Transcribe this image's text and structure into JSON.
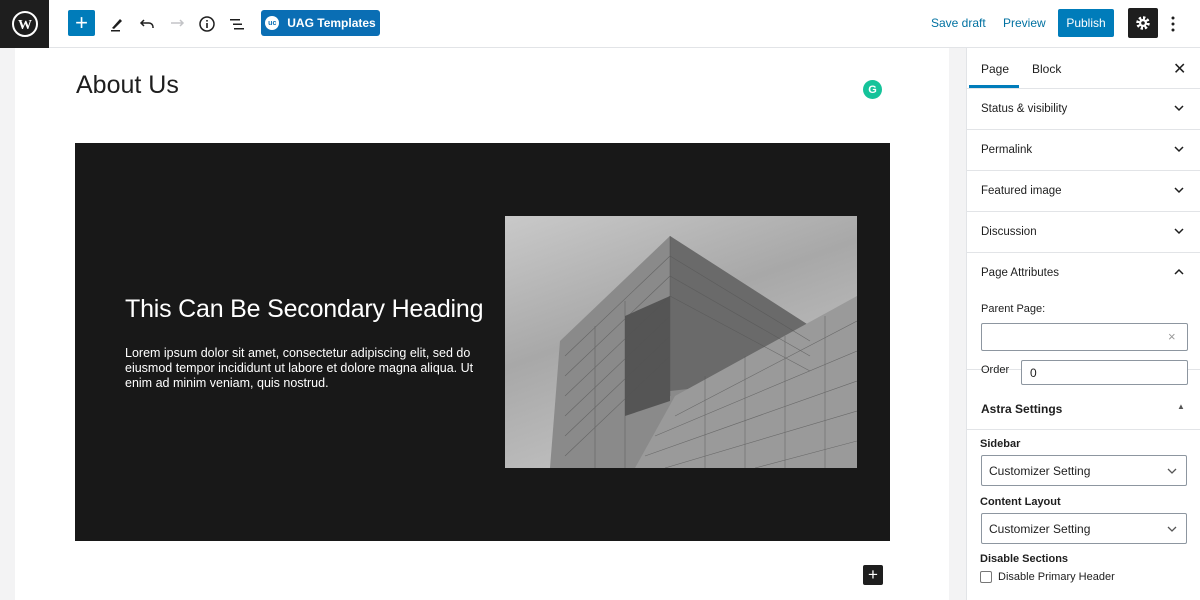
{
  "toolbar": {
    "uag_label": "UAG Templates",
    "uag_logo": "uc",
    "save_draft": "Save draft",
    "preview": "Preview",
    "publish": "Publish",
    "accent": "#007cba"
  },
  "editor": {
    "page_title": "About Us",
    "cover": {
      "heading": "This Can Be Secondary Heading",
      "paragraph": "Lorem ipsum dolor sit amet, consectetur adipiscing elit, sed do eiusmod tempor incididunt ut labore et dolore magna aliqua. Ut enim ad minim veniam, quis nostrud.",
      "image_alt": "Black and white photo of a glass office building"
    }
  },
  "sidebar": {
    "tabs": [
      {
        "label": "Page",
        "active": true
      },
      {
        "label": "Block",
        "active": false
      }
    ],
    "panels": [
      {
        "label": "Status & visibility",
        "open": false
      },
      {
        "label": "Permalink",
        "open": false
      },
      {
        "label": "Featured image",
        "open": false
      },
      {
        "label": "Discussion",
        "open": false
      },
      {
        "label": "Page Attributes",
        "open": true
      }
    ],
    "page_attributes": {
      "parent_label": "Parent Page:",
      "parent_value": "",
      "order_label": "Order",
      "order_value": "0"
    },
    "astra": {
      "title": "Astra Settings",
      "sidebar_label": "Sidebar",
      "sidebar_value": "Customizer Setting",
      "layout_label": "Content Layout",
      "layout_value": "Customizer Setting",
      "disable_label": "Disable Sections",
      "disable_primary_header": "Disable Primary Header",
      "disable_primary_header_checked": false
    }
  }
}
